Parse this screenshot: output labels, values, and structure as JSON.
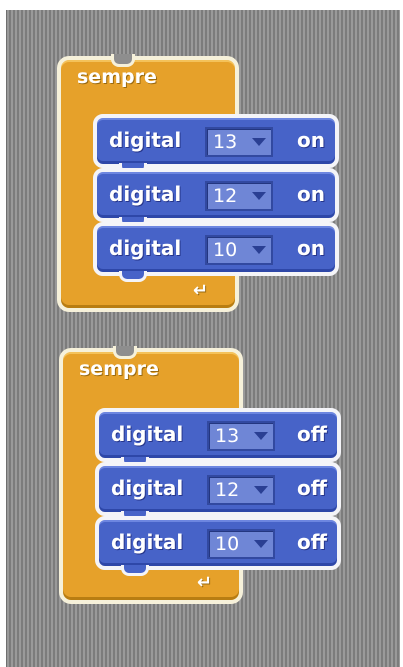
{
  "scripts": [
    {
      "loop_label": "sempre",
      "commands": [
        {
          "label": "digital",
          "pin": "13",
          "state": "on"
        },
        {
          "label": "digital",
          "pin": "12",
          "state": "on"
        },
        {
          "label": "digital",
          "pin": "10",
          "state": "on"
        }
      ]
    },
    {
      "loop_label": "sempre",
      "commands": [
        {
          "label": "digital",
          "pin": "13",
          "state": "off"
        },
        {
          "label": "digital",
          "pin": "12",
          "state": "off"
        },
        {
          "label": "digital",
          "pin": "10",
          "state": "off"
        }
      ]
    }
  ],
  "colors": {
    "control_block": "#e6a12a",
    "command_block": "#4763c8",
    "workspace": "#8e8e8e"
  },
  "icons": {
    "loop_arrow": "loop-return-arrow-icon",
    "dropdown": "dropdown-arrow-icon"
  }
}
